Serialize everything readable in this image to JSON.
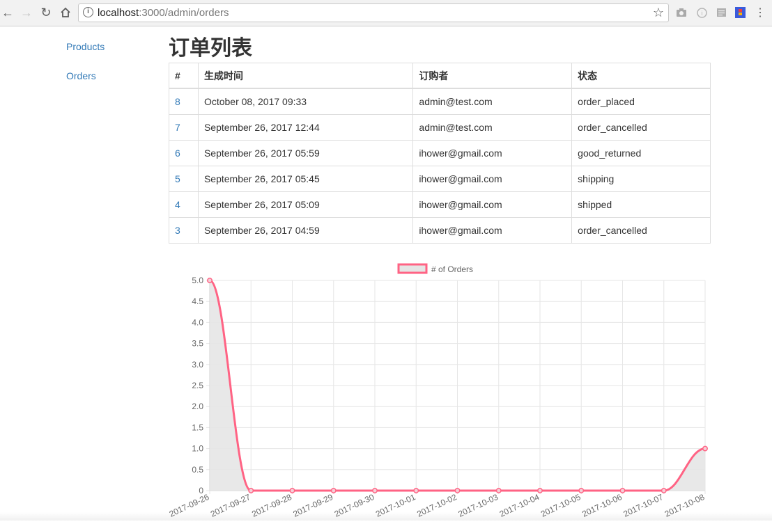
{
  "browser": {
    "url_host": "localhost",
    "url_path": ":3000/admin/orders",
    "icons": [
      "back-icon",
      "forward-icon",
      "reload-icon",
      "home-icon",
      "info-icon",
      "star-icon",
      "camera-icon",
      "extension-icon",
      "reader-icon",
      "extension-colored-icon",
      "menu-icon"
    ]
  },
  "sidebar": {
    "items": [
      {
        "label": "Products"
      },
      {
        "label": "Orders"
      }
    ]
  },
  "page": {
    "title": "订单列表"
  },
  "table": {
    "headers": [
      "#",
      "生成时间",
      "订购者",
      "状态"
    ],
    "rows": [
      {
        "id": "8",
        "created": "October 08, 2017 09:33",
        "buyer": "admin@test.com",
        "status": "order_placed"
      },
      {
        "id": "7",
        "created": "September 26, 2017 12:44",
        "buyer": "admin@test.com",
        "status": "order_cancelled"
      },
      {
        "id": "6",
        "created": "September 26, 2017 05:59",
        "buyer": "ihower@gmail.com",
        "status": "good_returned"
      },
      {
        "id": "5",
        "created": "September 26, 2017 05:45",
        "buyer": "ihower@gmail.com",
        "status": "shipping"
      },
      {
        "id": "4",
        "created": "September 26, 2017 05:09",
        "buyer": "ihower@gmail.com",
        "status": "shipped"
      },
      {
        "id": "3",
        "created": "September 26, 2017 04:59",
        "buyer": "ihower@gmail.com",
        "status": "order_cancelled"
      }
    ]
  },
  "chart_data": {
    "type": "line",
    "legend": "# of Orders",
    "legend_position": "top-center",
    "x": [
      "2017-09-26",
      "2017-09-27",
      "2017-09-28",
      "2017-09-29",
      "2017-09-30",
      "2017-10-01",
      "2017-10-02",
      "2017-10-03",
      "2017-10-04",
      "2017-10-05",
      "2017-10-06",
      "2017-10-07",
      "2017-10-08"
    ],
    "series": [
      {
        "name": "# of Orders",
        "values": [
          5,
          0,
          0,
          0,
          0,
          0,
          0,
          0,
          0,
          0,
          0,
          0,
          1
        ]
      }
    ],
    "ylim": [
      0,
      5
    ],
    "yticks": [
      "0",
      "0.5",
      "1.0",
      "1.5",
      "2.0",
      "2.5",
      "3.0",
      "3.5",
      "4.0",
      "4.5",
      "5.0"
    ],
    "grid": true,
    "fill": true,
    "line_color": "#ff6384",
    "fill_color": "#e5e5e5"
  }
}
